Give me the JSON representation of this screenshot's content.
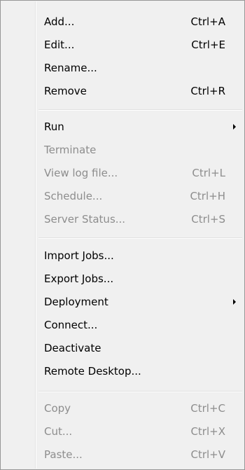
{
  "menu": {
    "items": [
      {
        "label": "Add...",
        "shortcut": "Ctrl+A",
        "enabled": true
      },
      {
        "label": "Edit...",
        "shortcut": "Ctrl+E",
        "enabled": true
      },
      {
        "label": "Rename...",
        "shortcut": "",
        "enabled": true
      },
      {
        "label": "Remove",
        "shortcut": "Ctrl+R",
        "enabled": true
      },
      {
        "label": "Run",
        "shortcut": "",
        "enabled": true,
        "submenu": true
      },
      {
        "label": "Terminate",
        "shortcut": "",
        "enabled": false
      },
      {
        "label": "View log file...",
        "shortcut": "Ctrl+L",
        "enabled": false
      },
      {
        "label": "Schedule...",
        "shortcut": "Ctrl+H",
        "enabled": false
      },
      {
        "label": "Server Status...",
        "shortcut": "Ctrl+S",
        "enabled": false
      },
      {
        "label": "Import Jobs...",
        "shortcut": "",
        "enabled": true
      },
      {
        "label": "Export Jobs...",
        "shortcut": "",
        "enabled": true
      },
      {
        "label": "Deployment",
        "shortcut": "",
        "enabled": true,
        "submenu": true
      },
      {
        "label": "Connect...",
        "shortcut": "",
        "enabled": true
      },
      {
        "label": "Deactivate",
        "shortcut": "",
        "enabled": true
      },
      {
        "label": "Remote Desktop...",
        "shortcut": "",
        "enabled": true
      },
      {
        "label": "Copy",
        "shortcut": "Ctrl+C",
        "enabled": false
      },
      {
        "label": "Cut...",
        "shortcut": "Ctrl+X",
        "enabled": false
      },
      {
        "label": "Paste...",
        "shortcut": "Ctrl+V",
        "enabled": false
      }
    ],
    "submenu_icon": "chevron-right-icon",
    "colors": {
      "background": "#f0f0f0",
      "text": "#000000",
      "disabled_text": "#8d8d8d",
      "border": "#979797"
    }
  }
}
